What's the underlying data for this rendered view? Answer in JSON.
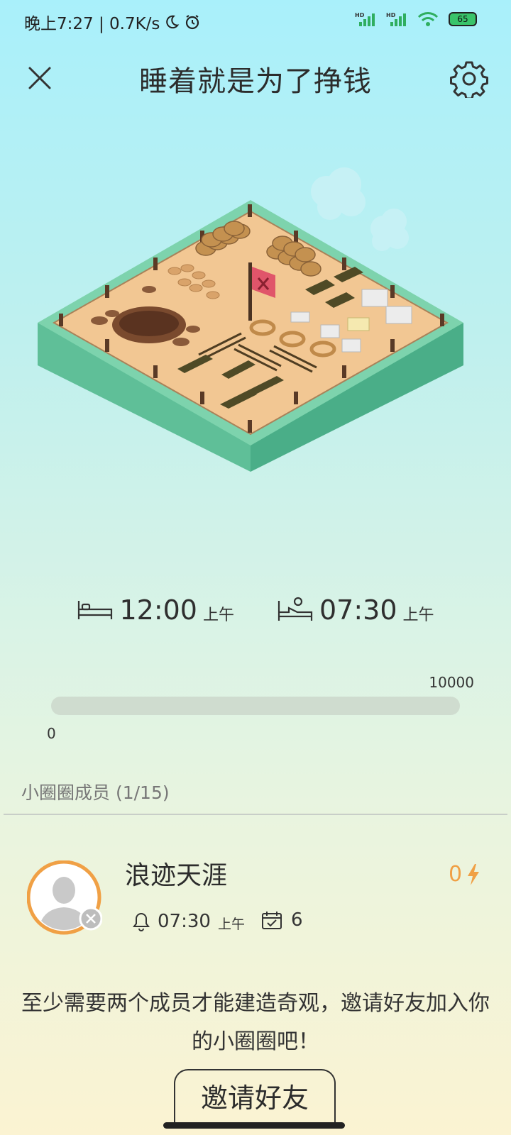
{
  "status_bar": {
    "time_text": "晚上7:27 | 0.7K/s",
    "battery": "65"
  },
  "header": {
    "title": "睡着就是为了挣钱",
    "close_icon": "close-icon",
    "settings_icon": "gear-icon"
  },
  "schedule": {
    "bedtime": "12:00",
    "bedtime_ampm": "上午",
    "wake_time": "07:30",
    "wake_ampm": "上午"
  },
  "progress": {
    "min": "0",
    "max": "10000",
    "current_fraction": 0
  },
  "members": {
    "label": "小圈圈成员",
    "count": "(1/15)",
    "list": [
      {
        "name": "浪迹天涯",
        "energy": "0",
        "alarm_time": "07:30",
        "alarm_ampm": "上午",
        "days": "6"
      }
    ]
  },
  "message": "至少需要两个成员才能建造奇观，邀请好友加入你的小圈圈吧！",
  "invite_button": "邀请好友",
  "colors": {
    "accent_orange": "#f0a045",
    "progress_track": "#cfdccf"
  }
}
